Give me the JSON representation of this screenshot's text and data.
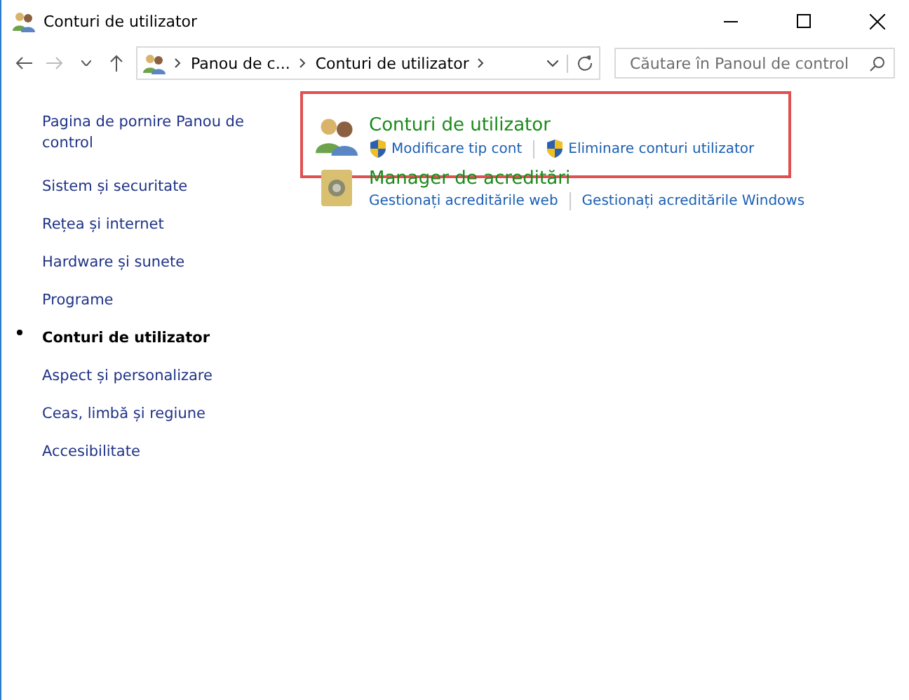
{
  "window": {
    "title": "Conturi de utilizator"
  },
  "address": {
    "crumbs": [
      "Panou de c...",
      "Conturi de utilizator"
    ]
  },
  "search": {
    "placeholder": "Căutare în Panoul de control"
  },
  "sidebar": {
    "items": [
      {
        "label": "Pagina de pornire Panou de control",
        "selected": false
      },
      {
        "label": "Sistem și securitate",
        "selected": false
      },
      {
        "label": "Rețea și internet",
        "selected": false
      },
      {
        "label": "Hardware și sunete",
        "selected": false
      },
      {
        "label": "Programe",
        "selected": false
      },
      {
        "label": "Conturi de utilizator",
        "selected": true
      },
      {
        "label": "Aspect și personalizare",
        "selected": false
      },
      {
        "label": "Ceas, limbă și regiune",
        "selected": false
      },
      {
        "label": "Accesibilitate",
        "selected": false
      }
    ]
  },
  "categories": [
    {
      "kind": "users",
      "title": "Conturi de utilizator",
      "highlighted": true,
      "links": [
        {
          "label": "Modificare tip cont",
          "shield": true
        },
        {
          "label": "Eliminare conturi utilizator",
          "shield": true
        }
      ]
    },
    {
      "kind": "vault",
      "title": "Manager de acreditări",
      "highlighted": false,
      "links": [
        {
          "label": "Gestionați acreditările web",
          "shield": false
        },
        {
          "label": "Gestionați acreditările Windows",
          "shield": false
        }
      ]
    }
  ]
}
